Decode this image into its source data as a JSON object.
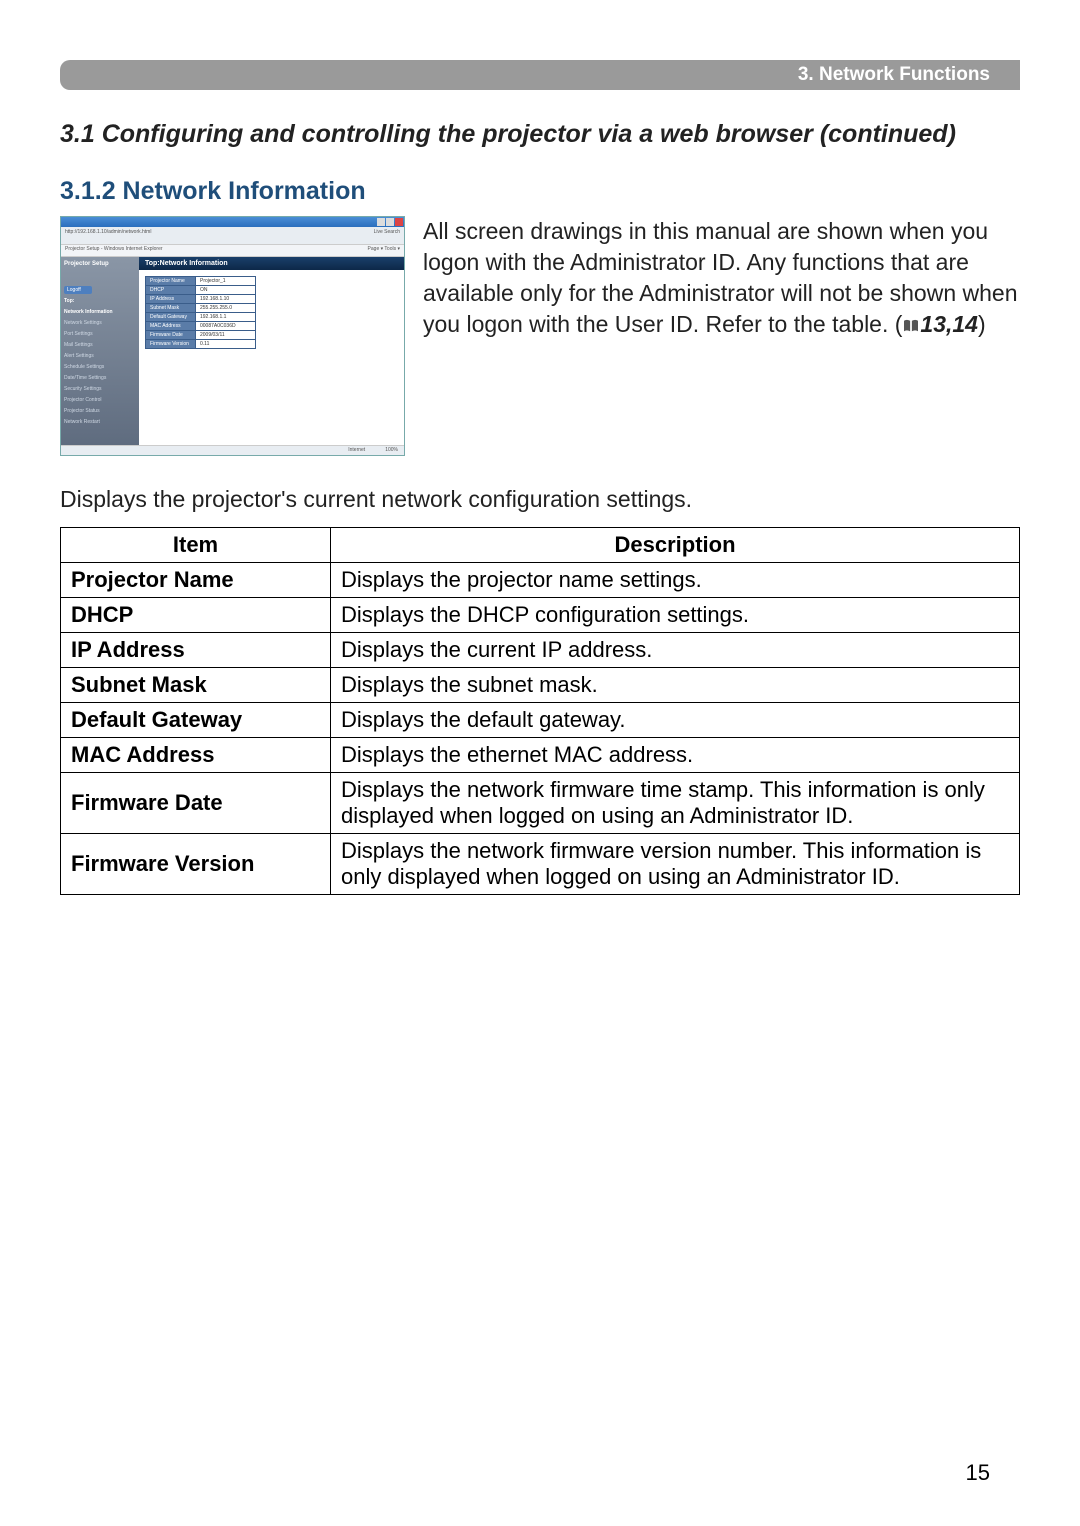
{
  "header": {
    "title": "3. Network Functions"
  },
  "section": {
    "title": "3.1 Configuring and controlling the projector via a web browser (continued)"
  },
  "subsection": {
    "title": "3.1.2 Network Information"
  },
  "intro_text": "All screen drawings in this manual are shown when you logon with the Administrator ID. Any functions that are available only for the Administrator will not be shown when you logon with the User ID. Refer to the table. (",
  "ref": "13,14",
  "intro_close": ")",
  "caption": "Displays the projector's current network configuration settings.",
  "table_headers": {
    "item": "Item",
    "description": "Description"
  },
  "table_rows": [
    {
      "item": "Projector Name",
      "desc": "Displays the projector name settings."
    },
    {
      "item": "DHCP",
      "desc": "Displays the DHCP configuration settings."
    },
    {
      "item": "IP Address",
      "desc": "Displays the current IP address."
    },
    {
      "item": "Subnet Mask",
      "desc": "Displays the subnet mask."
    },
    {
      "item": "Default Gateway",
      "desc": "Displays the default gateway."
    },
    {
      "item": "MAC Address",
      "desc": "Displays the ethernet MAC address."
    },
    {
      "item": "Firmware Date",
      "desc": "Displays the network firmware time stamp. This information is only displayed when logged on using an Administrator ID."
    },
    {
      "item": "Firmware Version",
      "desc": "Displays the network firmware version number. This information is only displayed when logged on using an Administrator ID."
    }
  ],
  "screenshot": {
    "window_title": "Projector Setup - Windows Internet Explorer",
    "address": "http://192.168.1.10/admin/network.html",
    "sidebar_title": "Projector Setup",
    "logoff": "Logoff",
    "sidebar_items": [
      {
        "label": "Top:",
        "active": true
      },
      {
        "label": "Network Information",
        "active": true
      },
      {
        "label": "Network Settings",
        "active": false
      },
      {
        "label": "Port Settings",
        "active": false
      },
      {
        "label": "Mail Settings",
        "active": false
      },
      {
        "label": "Alert Settings",
        "active": false
      },
      {
        "label": "Schedule Settings",
        "active": false
      },
      {
        "label": "Date/Time Settings",
        "active": false
      },
      {
        "label": "Security Settings",
        "active": false
      },
      {
        "label": "Projector Control",
        "active": false
      },
      {
        "label": "Projector Status",
        "active": false
      },
      {
        "label": "Network Restart",
        "active": false
      }
    ],
    "main_header": "Top:Network Information",
    "info_rows": [
      {
        "k": "Projector Name",
        "v": "Projector_1"
      },
      {
        "k": "DHCP",
        "v": "ON"
      },
      {
        "k": "IP Address",
        "v": "192.168.1.10"
      },
      {
        "k": "Subnet Mask",
        "v": "255.255.255.0"
      },
      {
        "k": "Default Gateway",
        "v": "192.168.1.1"
      },
      {
        "k": "MAC Address",
        "v": "00087A0C036D"
      },
      {
        "k": "Firmware Date",
        "v": "2009/03/11"
      },
      {
        "k": "Firmware Version",
        "v": "0.11"
      }
    ],
    "status_left": "Internet",
    "status_right": "100%"
  },
  "page_number": "15"
}
